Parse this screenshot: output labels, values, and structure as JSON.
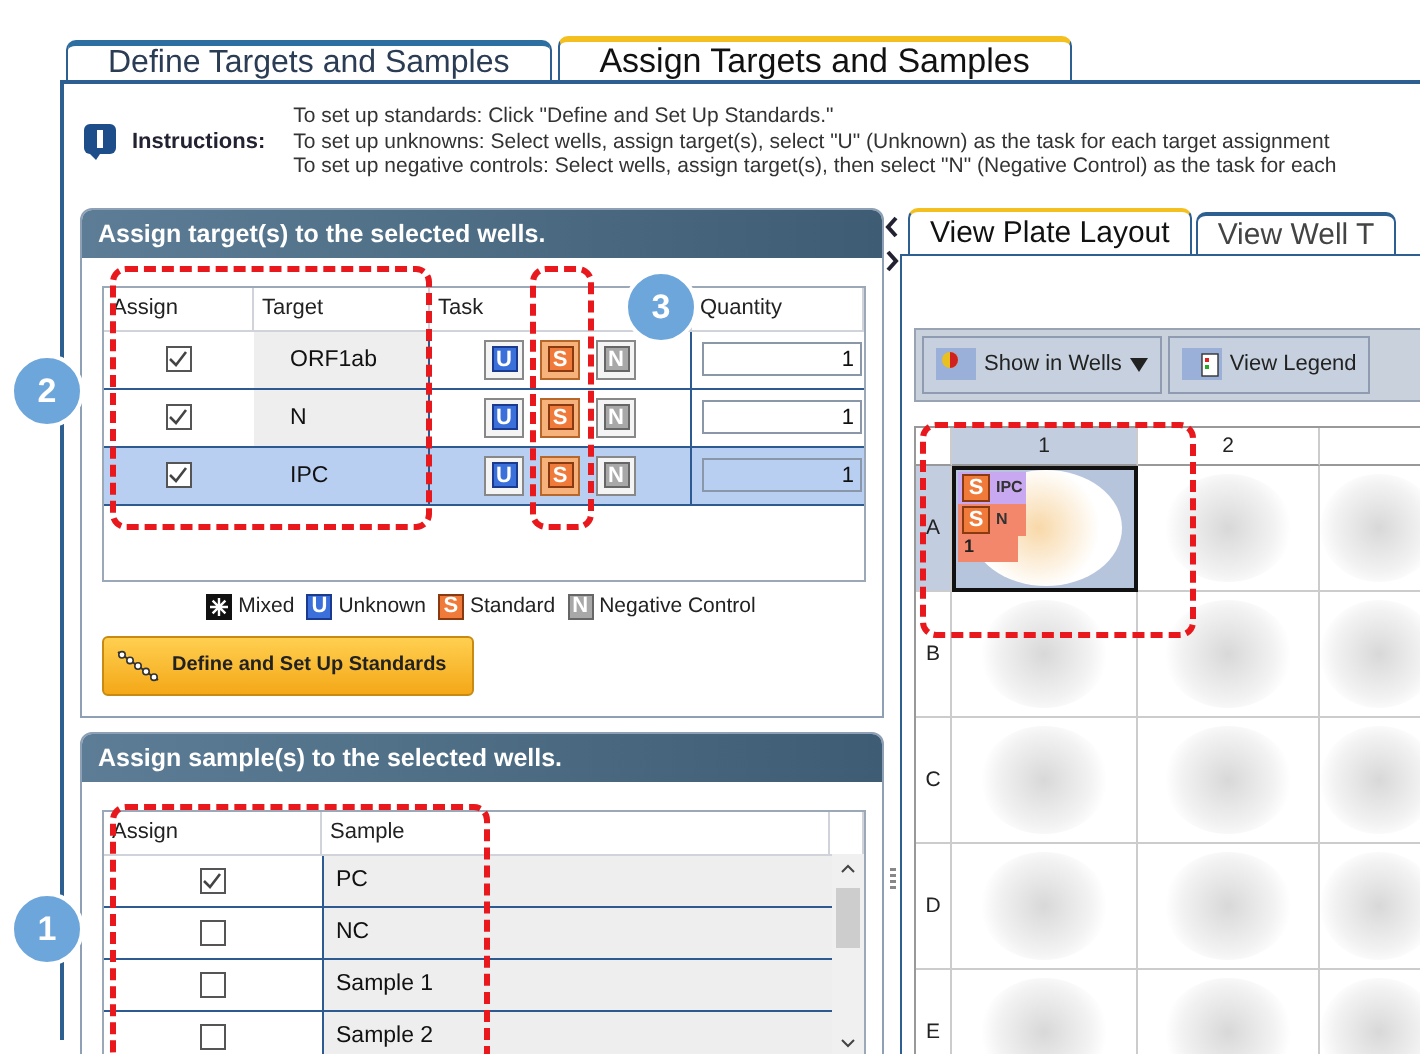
{
  "tabs": [
    {
      "label": "Define Targets and Samples",
      "selected": false
    },
    {
      "label": "Assign Targets and Samples",
      "selected": true
    }
  ],
  "instructions": {
    "label": "Instructions:",
    "lines": [
      "To set up standards: Click \"Define and Set Up Standards.\"",
      "To set up unknowns: Select wells, assign target(s), select \"U\" (Unknown) as the task for each target assignment",
      "To set up negative controls: Select wells, assign target(s), then select \"N\" (Negative Control) as the task for each"
    ]
  },
  "target_panel": {
    "title": "Assign target(s) to the selected wells.",
    "columns": [
      "Assign",
      "Target",
      "Task",
      "Quantity"
    ],
    "rows": [
      {
        "checked": true,
        "target": "ORF1ab",
        "selected": false,
        "quantity": "1",
        "tasks": [
          {
            "kind": "unknown",
            "letter": "U",
            "selected": false
          },
          {
            "kind": "standard",
            "letter": "S",
            "selected": true
          },
          {
            "kind": "negative",
            "letter": "N",
            "selected": false
          }
        ]
      },
      {
        "checked": true,
        "target": "N",
        "selected": false,
        "quantity": "1",
        "tasks": [
          {
            "kind": "unknown",
            "letter": "U",
            "selected": false
          },
          {
            "kind": "standard",
            "letter": "S",
            "selected": true
          },
          {
            "kind": "negative",
            "letter": "N",
            "selected": false
          }
        ]
      },
      {
        "checked": true,
        "target": "IPC",
        "selected": true,
        "quantity": "1",
        "tasks": [
          {
            "kind": "unknown",
            "letter": "U",
            "selected": false
          },
          {
            "kind": "standard",
            "letter": "S",
            "selected": true
          },
          {
            "kind": "negative",
            "letter": "N",
            "selected": false
          }
        ]
      }
    ],
    "legend": [
      {
        "kind": "mixed",
        "label": "Mixed"
      },
      {
        "kind": "unknown",
        "letter": "U",
        "label": "Unknown"
      },
      {
        "kind": "standard",
        "letter": "S",
        "label": "Standard"
      },
      {
        "kind": "negative",
        "letter": "N",
        "label": "Negative Control"
      }
    ],
    "standards_button": "Define and Set Up Standards"
  },
  "sample_panel": {
    "title": "Assign sample(s) to the selected wells.",
    "columns": [
      "Assign",
      "Sample"
    ],
    "rows": [
      {
        "checked": true,
        "sample": "PC"
      },
      {
        "checked": false,
        "sample": "NC"
      },
      {
        "checked": false,
        "sample": "Sample 1"
      },
      {
        "checked": false,
        "sample": "Sample 2"
      }
    ]
  },
  "plate_tabs": [
    {
      "label": "View Plate Layout",
      "selected": true
    },
    {
      "label": "View Well T",
      "selected": false
    }
  ],
  "toolbar": {
    "show_in_wells": "Show in Wells",
    "view_legend": "View Legend"
  },
  "plate": {
    "columns": [
      "1",
      "2"
    ],
    "rows": [
      "A",
      "B",
      "C",
      "D",
      "E"
    ],
    "well_a1": {
      "selected": true,
      "tags": [
        {
          "letter": "S",
          "target": "IPC",
          "color": "#c9a8f2"
        },
        {
          "letter": "S",
          "target": "N",
          "color": "#f2876b"
        }
      ],
      "quantity": "1"
    }
  },
  "callouts": [
    "2",
    "3",
    "1"
  ]
}
